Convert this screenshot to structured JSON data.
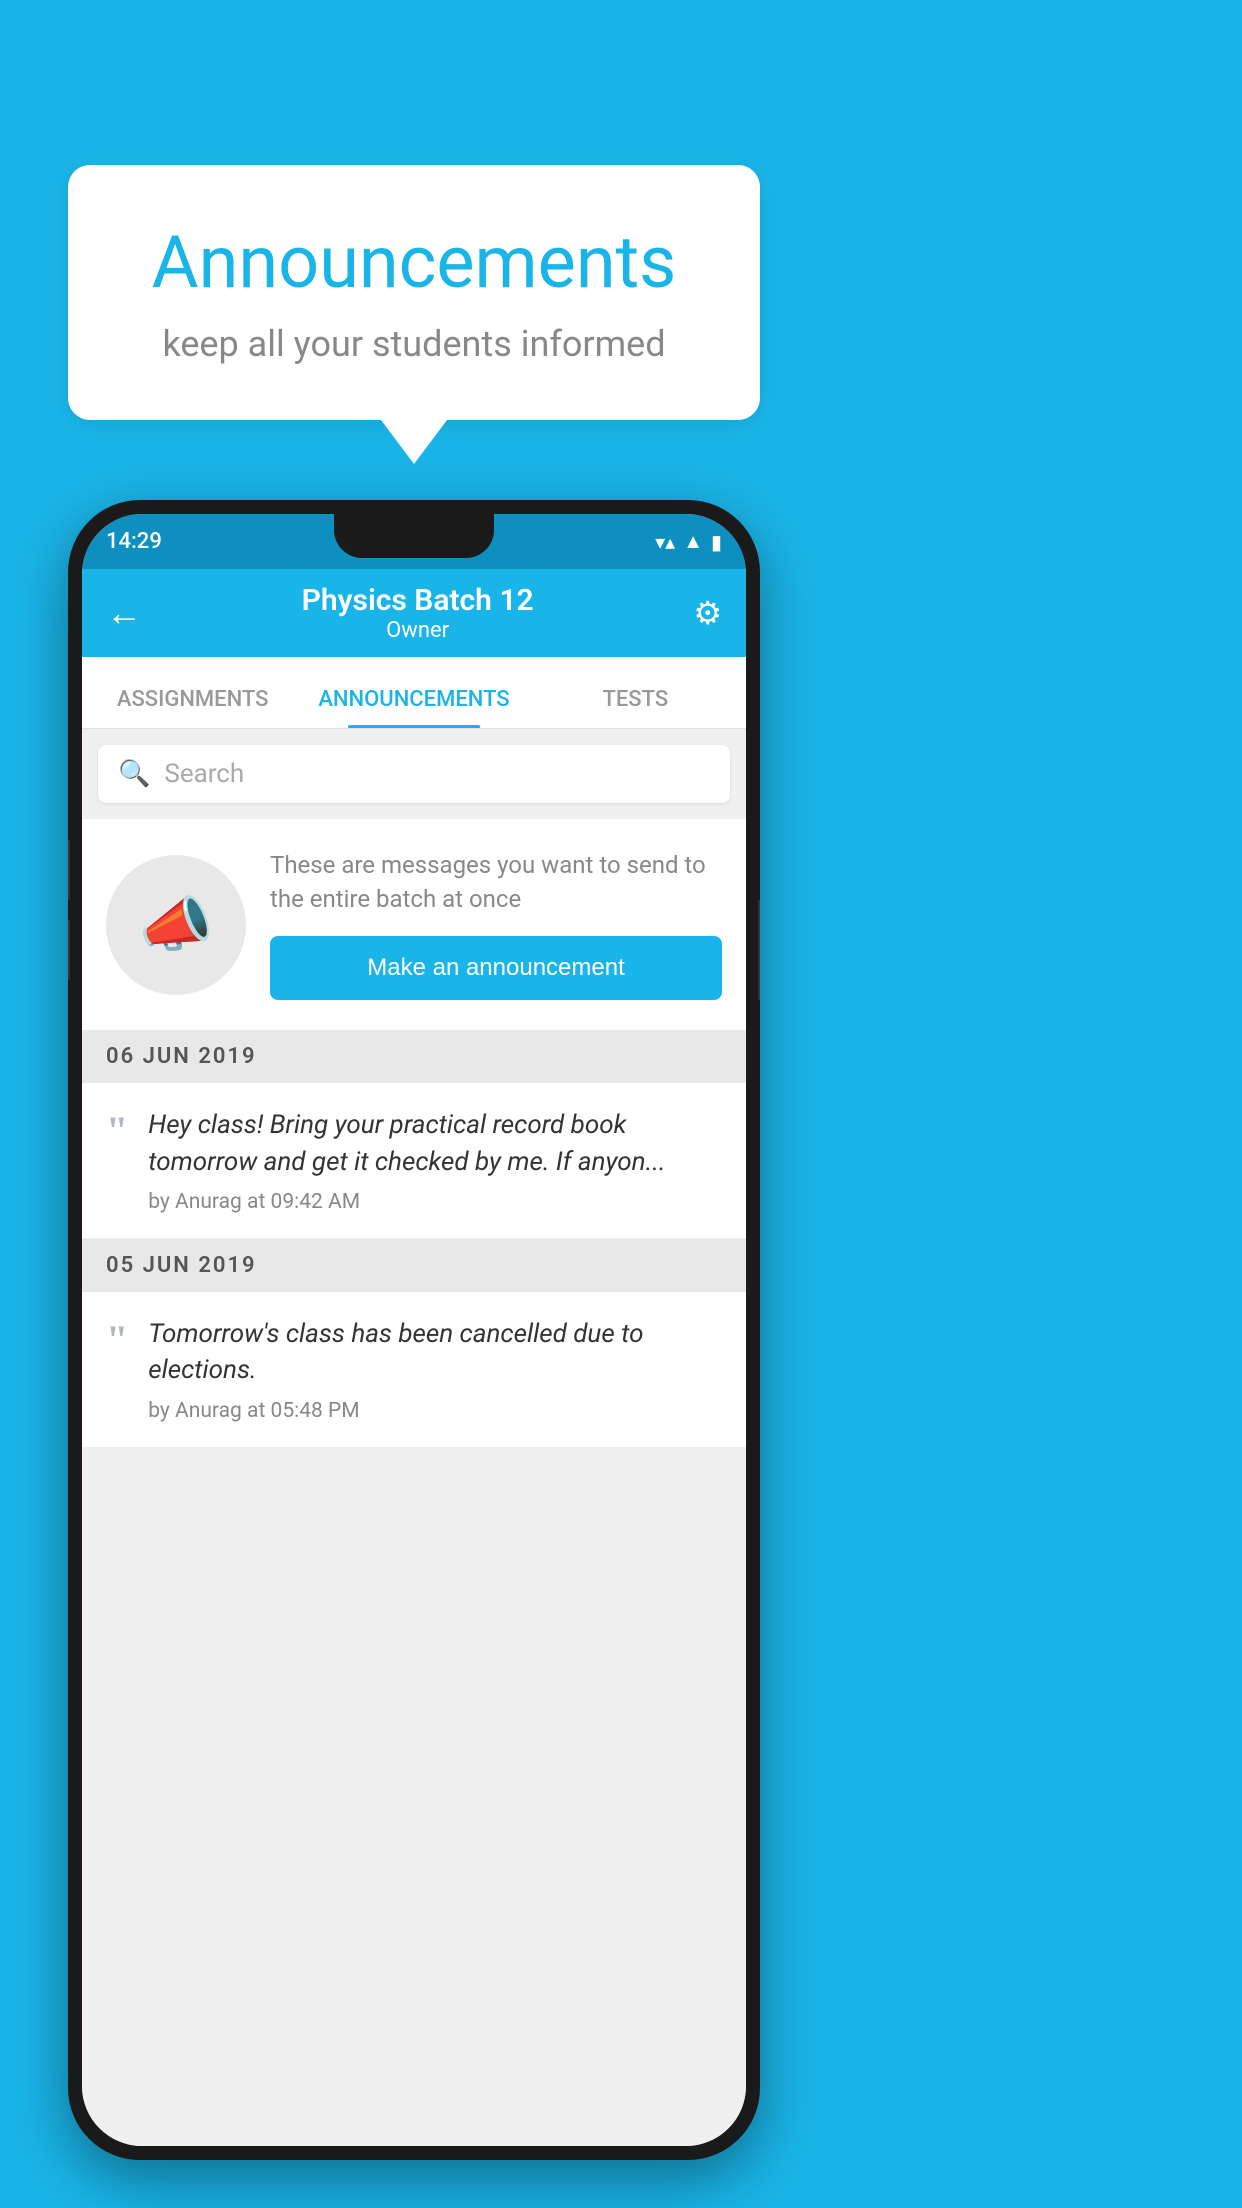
{
  "background_color": "#1ab5e8",
  "speech_bubble": {
    "title": "Announcements",
    "subtitle": "keep all your students informed"
  },
  "status_bar": {
    "time": "14:29",
    "wifi_icon": "▼",
    "signal_icon": "▲",
    "battery_icon": "▮"
  },
  "app_bar": {
    "back_icon": "←",
    "title": "Physics Batch 12",
    "subtitle": "Owner",
    "settings_icon": "⚙"
  },
  "tabs": [
    {
      "label": "ASSIGNMENTS",
      "active": false
    },
    {
      "label": "ANNOUNCEMENTS",
      "active": true
    },
    {
      "label": "TESTS",
      "active": false
    }
  ],
  "search": {
    "placeholder": "Search"
  },
  "promo": {
    "description": "These are messages you want to send to the entire batch at once",
    "button_label": "Make an announcement"
  },
  "announcements": [
    {
      "date": "06  JUN  2019",
      "text": "Hey class! Bring your practical record book tomorrow and get it checked by me. If anyon...",
      "meta": "by Anurag at 09:42 AM"
    },
    {
      "date": "05  JUN  2019",
      "text": "Tomorrow's class has been cancelled due to elections.",
      "meta": "by Anurag at 05:48 PM"
    }
  ]
}
